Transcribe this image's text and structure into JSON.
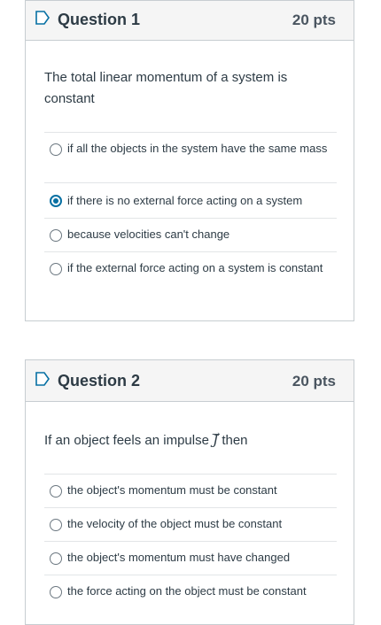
{
  "questions": [
    {
      "title": "Question 1",
      "points": "20 pts",
      "stem": "The total linear momentum of a system is constant",
      "answers": [
        {
          "text": "if all the objects in the system have the same mass",
          "selected": false
        },
        {
          "text": "if there is no external force acting on a system",
          "selected": true
        },
        {
          "text": "because velocities can't change",
          "selected": false
        },
        {
          "text": "if the external force acting on a system is constant",
          "selected": false
        }
      ]
    },
    {
      "title": "Question 2",
      "points": "20 pts",
      "stem_before": "If an object feels an impulse",
      "stem_symbol": "J",
      "stem_after": "then",
      "answers": [
        {
          "text": "the object's momentum must be constant",
          "selected": false
        },
        {
          "text": "the velocity of the object must be constant",
          "selected": false
        },
        {
          "text": "the object's momentum must have changed",
          "selected": false
        },
        {
          "text": "the force acting on the object must be constant",
          "selected": false
        }
      ]
    }
  ],
  "colors": {
    "accent": "#0770a3",
    "border": "#c7cdd1",
    "header_bg": "#f5f5f5"
  },
  "icons": {
    "bookmark": "bookmark-flag-icon"
  }
}
